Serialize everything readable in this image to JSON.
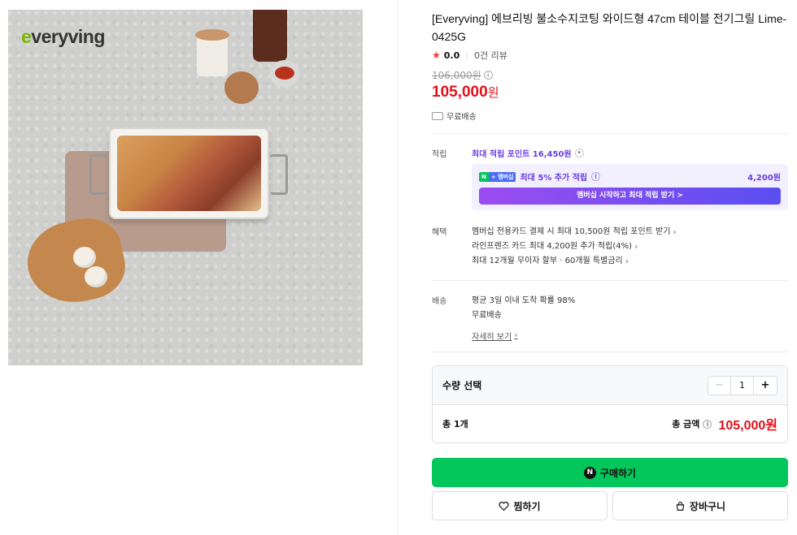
{
  "product": {
    "brand_logo": "everyving",
    "title": "[Everyving] 에브리빙 불소수지코팅 와이드형 47cm 테이블 전기그릴 Lime-0425G",
    "rating": "0.0",
    "reviews": "0건 리뷰",
    "original_price": "106,000원",
    "price": "105,000",
    "price_unit": "원",
    "delivery": "무료배송"
  },
  "points": {
    "label": "적립",
    "max_points": "최대 적립 포인트 16,450원",
    "member_badge_n": "N",
    "member_badge_plus": "+ 멤버십",
    "member_extra": "최대 5% 추가 적립",
    "member_amount": "4,200원",
    "member_button": "멤버십 시작하고 최대 적립 받기 >"
  },
  "benefits": {
    "label": "혜택",
    "items": [
      "멤버십 전용카드 결제 시 최대 10,500원 적립 포인트 받기",
      "라인프렌즈 카드 최대 4,200원 추가 적립(4%)",
      "최대 12개월 무이자 할부 · 60개월 특별금리"
    ]
  },
  "shipping": {
    "label": "배송",
    "arrival": "평균 3일 이내 도착 확률 98%",
    "fee": "무료배송",
    "detail_link": "자세히 보기"
  },
  "quantity": {
    "label": "수량 선택",
    "value": "1",
    "total_count_label": "총 1개",
    "total_amount_label": "총 금액",
    "total_price": "105,000원"
  },
  "actions": {
    "buy": "구매하기",
    "wish": "찜하기",
    "cart": "장바구니"
  },
  "colors": {
    "price_red": "#e2101b",
    "npay_green": "#03c75a",
    "member_purple": "#6a3ee0"
  }
}
